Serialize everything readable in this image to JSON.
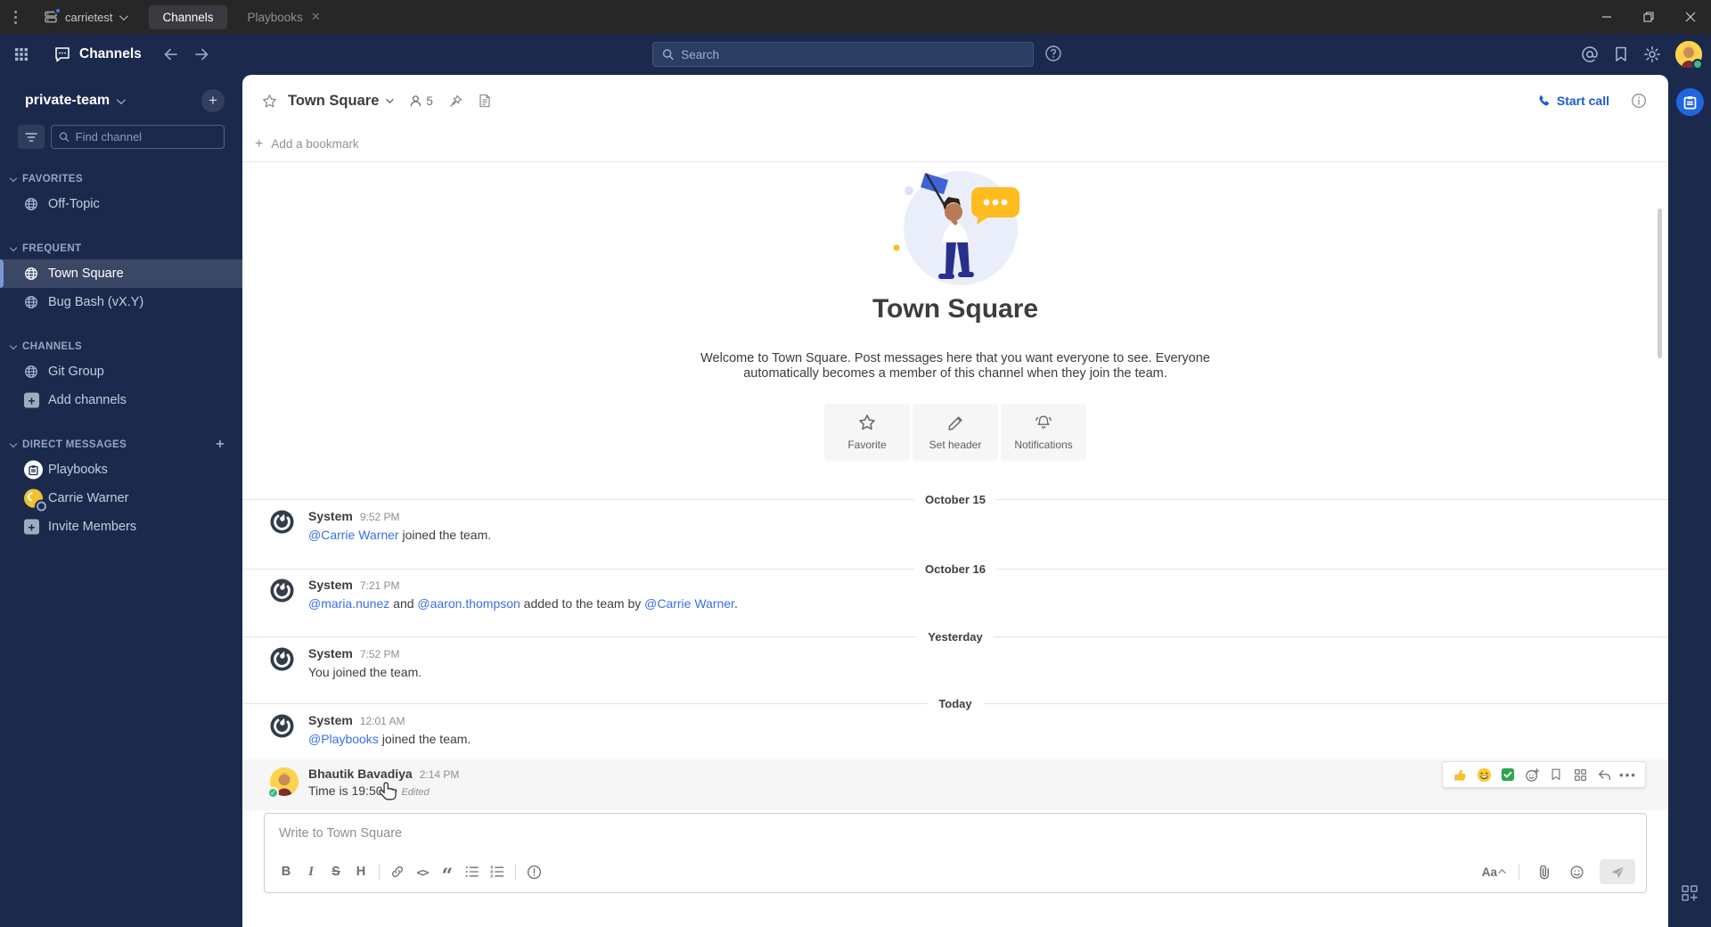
{
  "colors": {
    "accent": "#1c58d9",
    "link": "#386fe5",
    "sidebar_bg": "#1b2a4c",
    "titlebar_bg": "#272727",
    "online_green": "#3db887"
  },
  "titlebar": {
    "server_name": "carrietest",
    "tabs": [
      {
        "label": "Channels",
        "active": true
      },
      {
        "label": "Playbooks",
        "active": false
      }
    ]
  },
  "global_header": {
    "product_label": "Channels",
    "search_placeholder": "Search"
  },
  "sidebar": {
    "team_name": "private-team",
    "find_channel_placeholder": "Find channel",
    "sections": [
      {
        "label": "FAVORITES",
        "items": [
          {
            "label": "Off-Topic",
            "icon": "globe"
          }
        ]
      },
      {
        "label": "FREQUENT",
        "items": [
          {
            "label": "Town Square",
            "icon": "globe",
            "selected": true
          },
          {
            "label": "Bug Bash (vX.Y)",
            "icon": "globe"
          }
        ]
      },
      {
        "label": "CHANNELS",
        "items": [
          {
            "label": "Git Group",
            "icon": "globe"
          },
          {
            "label": "Add channels",
            "icon": "plus"
          }
        ]
      },
      {
        "label": "DIRECT MESSAGES",
        "has_add_button": true,
        "items": [
          {
            "label": "Playbooks",
            "icon": "playbooks-bot"
          },
          {
            "label": "Carrie Warner",
            "icon": "avatar-offline"
          },
          {
            "label": "Invite Members",
            "icon": "plus"
          }
        ]
      }
    ]
  },
  "channel_header": {
    "name": "Town Square",
    "member_count": "5",
    "start_call_label": "Start call"
  },
  "bookmark_bar": {
    "add_label": "Add a bookmark"
  },
  "intro": {
    "title": "Town Square",
    "description_line1": "Welcome to Town Square. Post messages here that you want everyone to see. Everyone",
    "description_line2": "automatically becomes a member of this channel when they join the team.",
    "actions": [
      {
        "label": "Favorite",
        "icon": "star"
      },
      {
        "label": "Set header",
        "icon": "pencil"
      },
      {
        "label": "Notifications",
        "icon": "bell"
      }
    ]
  },
  "feed": [
    {
      "type": "divider",
      "label": "October 15"
    },
    {
      "type": "post",
      "author": "System",
      "time": "9:52 PM",
      "segments": [
        {
          "text": "@Carrie Warner",
          "link": true
        },
        {
          "text": " joined the team.",
          "link": false
        }
      ]
    },
    {
      "type": "divider",
      "label": "October 16"
    },
    {
      "type": "post",
      "author": "System",
      "time": "7:21 PM",
      "segments": [
        {
          "text": "@maria.nunez",
          "link": true
        },
        {
          "text": " and ",
          "link": false
        },
        {
          "text": "@aaron.thompson",
          "link": true
        },
        {
          "text": " added to the team by ",
          "link": false
        },
        {
          "text": "@Carrie Warner",
          "link": true
        },
        {
          "text": ".",
          "link": false
        }
      ]
    },
    {
      "type": "divider",
      "label": "Yesterday"
    },
    {
      "type": "post",
      "author": "System",
      "time": "7:52 PM",
      "segments": [
        {
          "text": "You joined the team.",
          "link": false
        }
      ]
    },
    {
      "type": "divider",
      "label": "Today"
    },
    {
      "type": "post",
      "author": "System",
      "time": "12:01 AM",
      "segments": [
        {
          "text": "@Playbooks",
          "link": true
        },
        {
          "text": " joined the team.",
          "link": false
        }
      ]
    },
    {
      "type": "post",
      "author": "Bhautik Bavadiya",
      "time": "2:14 PM",
      "hovered": true,
      "edited_label": "Edited",
      "segments": [
        {
          "text": "Time is 19:50",
          "link": false
        }
      ]
    }
  ],
  "composer": {
    "placeholder": "Write to Town Square",
    "bold_label": "B",
    "italic_label": "I",
    "strike_label": "S",
    "heading_label": "H",
    "code_label": "<>",
    "quote_label": "“",
    "format_toggle_label": "Aa"
  }
}
